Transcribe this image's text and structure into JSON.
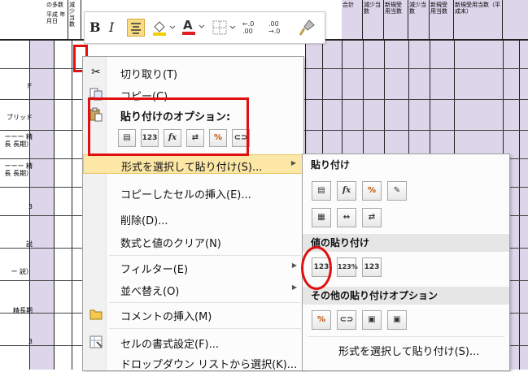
{
  "sheet": {
    "header_cells": [
      "の多数",
      "平成 年 月日",
      "減少当数",
      "合計",
      "減少当数",
      "新規受用当数",
      "減少当数",
      "新規受用当数",
      "新規受用当数（平成末）"
    ],
    "row_labels": [
      "ド",
      "ブリッド",
      "ーーー 精長 長期）",
      "ーーー 精長 長期）",
      "3",
      "説",
      "ー 説）",
      "精長期",
      "3"
    ]
  },
  "mini_toolbar": {
    "bold": "B",
    "italic": "I",
    "inc_decimal": "←.0 .00",
    "dec_decimal": ".00 →.0"
  },
  "menu": {
    "cut": "切り取り(T)",
    "copy": "コピー(C)",
    "paste_options_header": "貼り付けのオプション:",
    "paste_special": "形式を選択して貼り付け(S)...",
    "insert_copied": "コピーしたセルの挿入(E)...",
    "delete": "削除(D)...",
    "clear": "数式と値のクリア(N)",
    "filter": "フィルター(E)",
    "sort": "並べ替え(O)",
    "insert_comment": "コメントの挿入(M)",
    "format_cells": "セルの書式設定(F)...",
    "dropdown": "ドロップダウン リストから選択(K)..."
  },
  "submenu": {
    "paste_header": "貼り付け",
    "values_header": "値の貼り付け",
    "other_header": "その他の貼り付けオプション",
    "paste_special_footer": "形式を選択して貼り付け(S)..."
  }
}
